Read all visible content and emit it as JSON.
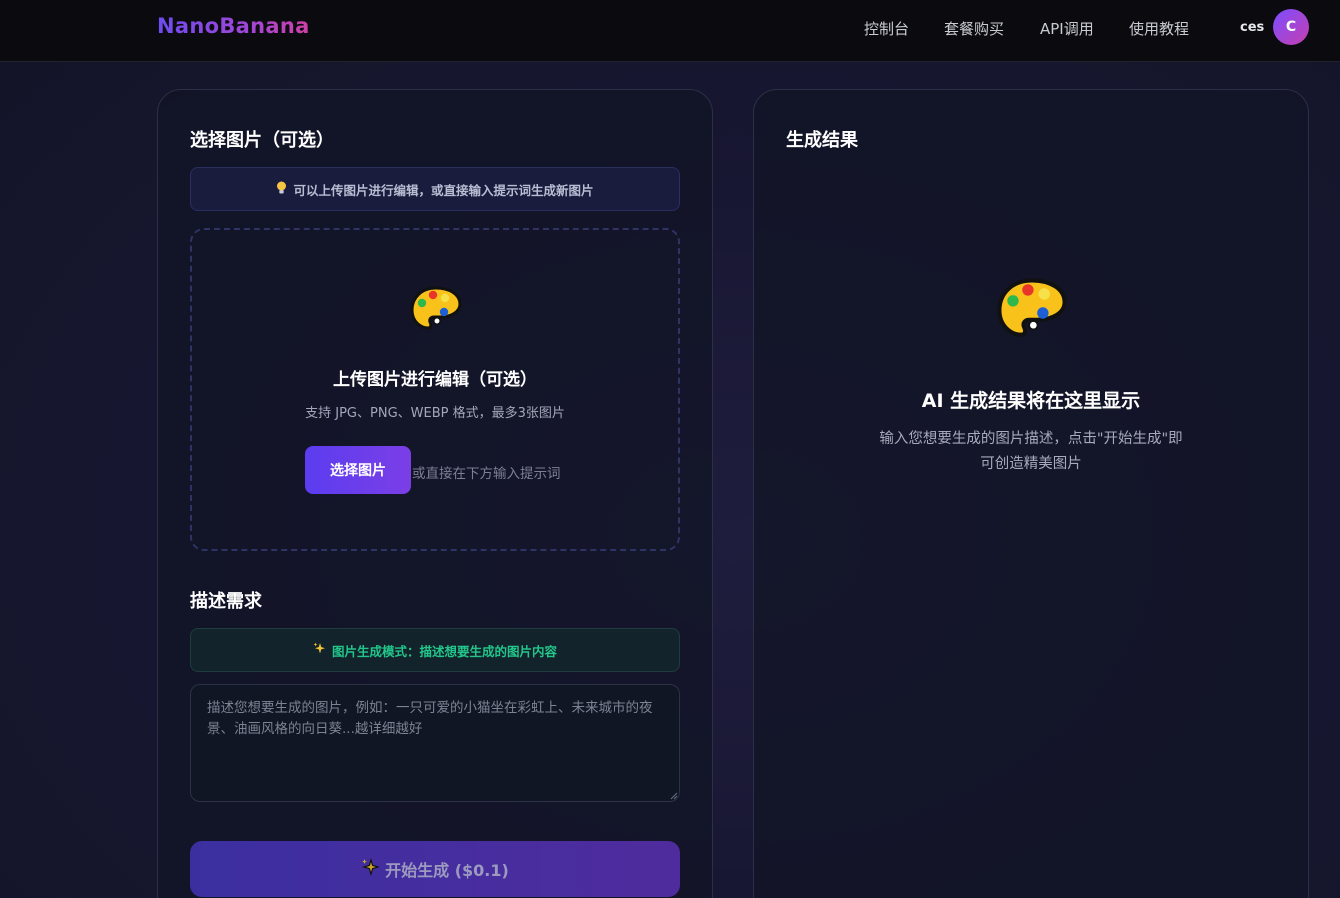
{
  "header": {
    "brand": "NanoBanana",
    "nav": [
      "控制台",
      "套餐购买",
      "API调用",
      "使用教程"
    ],
    "username": "ces",
    "avatar_letter": "C"
  },
  "left": {
    "upload_section_title": "选择图片（可选）",
    "upload_hint": "可以上传图片进行编辑，或直接输入提示词生成新图片",
    "upload_hint_icon": "lightbulb-icon",
    "dropzone_icon": "palette-icon",
    "dropzone_title": "上传图片进行编辑（可选）",
    "dropzone_subtitle": "支持 JPG、PNG、WEBP 格式，最多3张图片",
    "choose_button": "选择图片",
    "or_text": "或直接在下方输入提示词",
    "describe_section_title": "描述需求",
    "mode_hint": "图片生成模式：描述想要生成的图片内容",
    "mode_hint_icon": "sparkles-icon",
    "prompt_value": "",
    "prompt_placeholder": "描述您想要生成的图片，例如：一只可爱的小猫坐在彩虹上、未来城市的夜景、油画风格的向日葵...越详细越好",
    "generate_button": "开始生成 ($0.1)",
    "generate_icon": "sparkles-icon"
  },
  "right": {
    "section_title": "生成结果",
    "icon": "palette-icon",
    "placeholder_title": "AI 生成结果将在这里显示",
    "placeholder_desc": "输入您想要生成的图片描述，点击\"开始生成\"即可创造精美图片"
  },
  "colors": {
    "accent": "#6d4cf0",
    "success": "#22c58a",
    "background": "#181733"
  }
}
